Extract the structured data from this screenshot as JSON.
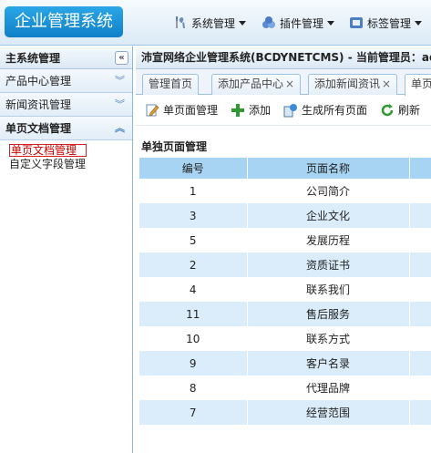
{
  "app": {
    "logo": "企业管理系统"
  },
  "topmenu": [
    {
      "label": "系统管理",
      "icon": "wrench-icon"
    },
    {
      "label": "插件管理",
      "icon": "puzzle-icon"
    },
    {
      "label": "标签管理",
      "icon": "tag-icon"
    }
  ],
  "sidebar": {
    "title": "主系统管理",
    "collapse_glyph": "«",
    "groups": [
      {
        "label": "产品中心管理",
        "chevron": "︾"
      },
      {
        "label": "新闻资讯管理",
        "chevron": "︾"
      },
      {
        "label": "单页文档管理",
        "chevron": "︽"
      }
    ],
    "items": [
      "单页文档管理",
      "自定义字段管理"
    ]
  },
  "breadcrumb": "沛宣网络企业管理系统(BCDYNETCMS) - 当前管理员：admin",
  "tabs": [
    {
      "label": "管理首页",
      "close": ""
    },
    {
      "label": "添加产品中心",
      "close": "×"
    },
    {
      "label": "添加新闻资讯",
      "close": "×"
    },
    {
      "label": "单页",
      "close": ""
    }
  ],
  "toolbar": {
    "page_manage": "单页面管理",
    "add": "添加",
    "generate_all": "生成所有页面",
    "refresh": "刷新"
  },
  "section_title": "单独页面管理",
  "table": {
    "headers": [
      "编号",
      "页面名称",
      ""
    ],
    "rows": [
      [
        "1",
        "公司简介"
      ],
      [
        "3",
        "企业文化"
      ],
      [
        "5",
        "发展历程"
      ],
      [
        "2",
        "资质证书"
      ],
      [
        "4",
        "联系我们"
      ],
      [
        "11",
        "售后服务"
      ],
      [
        "10",
        "联系方式"
      ],
      [
        "9",
        "客户名录"
      ],
      [
        "8",
        "代理品牌"
      ],
      [
        "7",
        "经营范围"
      ]
    ]
  },
  "colors": {
    "accent": "#1a90d8",
    "header_row": "#a6d4f2",
    "alt_row": "#dbedfa",
    "selected_border": "#d42020"
  }
}
